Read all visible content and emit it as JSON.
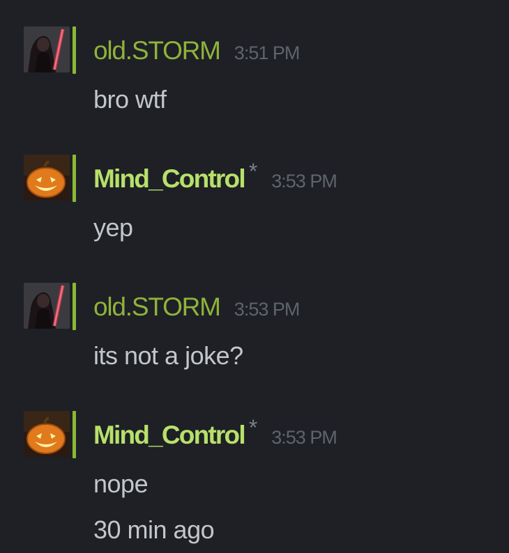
{
  "colors": {
    "background": "#1e2025",
    "online_name": "#8fb33b",
    "ingame_name": "#b7e06a",
    "status_online": "#8ab834",
    "message_text": "#c3c6cb",
    "timestamp": "#5f646c"
  },
  "messages": [
    {
      "sender": "old.STORM",
      "avatar_icon": "sith-lightsaber-avatar-icon",
      "status": "online",
      "time": "3:51 PM",
      "lines": [
        "bro wtf"
      ]
    },
    {
      "sender": "Mind_Control",
      "avatar_icon": "pumpkin-avatar-icon",
      "status": "in-game",
      "marker": "*",
      "time": "3:53 PM",
      "lines": [
        "yep"
      ]
    },
    {
      "sender": "old.STORM",
      "avatar_icon": "sith-lightsaber-avatar-icon",
      "status": "online",
      "time": "3:53 PM",
      "lines": [
        "its not a joke?"
      ]
    },
    {
      "sender": "Mind_Control",
      "avatar_icon": "pumpkin-avatar-icon",
      "status": "in-game",
      "marker": "*",
      "time": "3:53 PM",
      "lines": [
        "nope",
        "30 min ago"
      ]
    }
  ]
}
